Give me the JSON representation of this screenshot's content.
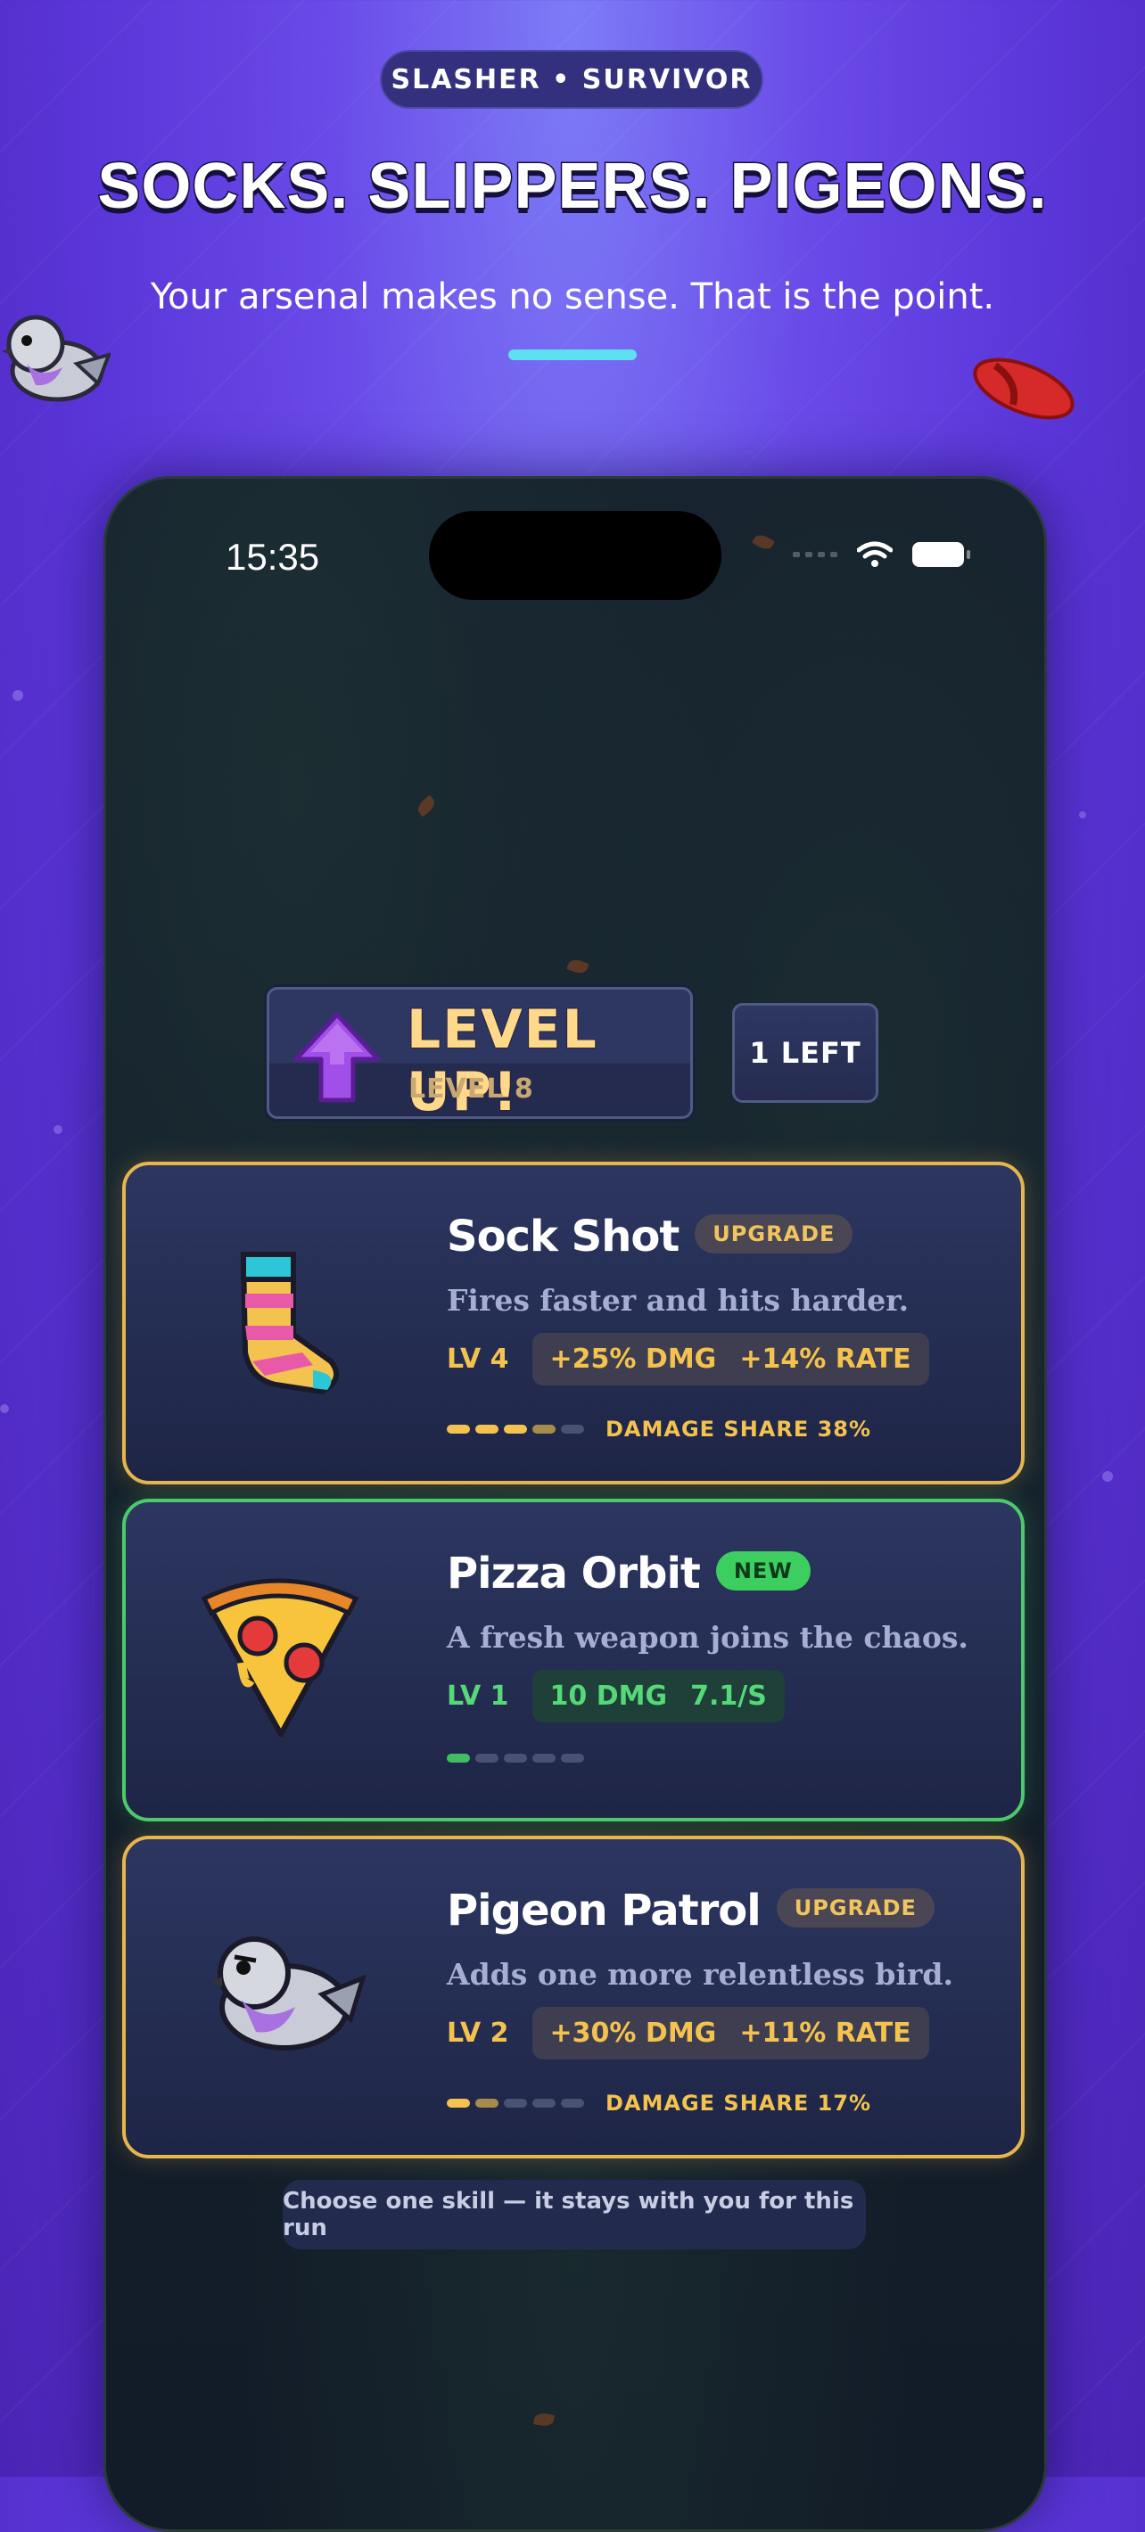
{
  "header": {
    "tag": "SLASHER • SURVIVOR",
    "headline": "SOCKS. SLIPPERS. PIGEONS.",
    "subtitle": "Your arsenal makes no sense. That is the point."
  },
  "status_bar": {
    "time": "15:35"
  },
  "level_up": {
    "title": "LEVEL UP!",
    "subtitle": "LEVEL 8",
    "remaining": "1 LEFT"
  },
  "cards": [
    {
      "title": "Sock Shot",
      "badge": "UPGRADE",
      "description": "Fires faster and hits harder.",
      "level": "LV 4",
      "stats": [
        "+25% DMG",
        "+14% RATE"
      ],
      "damage_share": "DAMAGE SHARE 38%",
      "icon": "sock-icon"
    },
    {
      "title": "Pizza Orbit",
      "badge": "NEW",
      "description": "A fresh weapon joins the chaos.",
      "level": "LV 1",
      "stats": [
        "10 DMG",
        "7.1/S"
      ],
      "icon": "pizza-icon"
    },
    {
      "title": "Pigeon Patrol",
      "badge": "UPGRADE",
      "description": "Adds one more relentless bird.",
      "level": "LV 2",
      "stats": [
        "+30% DMG",
        "+11% RATE"
      ],
      "damage_share": "DAMAGE SHARE 17%",
      "icon": "pigeon-icon"
    }
  ],
  "hint": "Choose one skill — it stays with you for this run",
  "colors": {
    "upgrade": "#e6b54e",
    "new": "#4cc96a",
    "accent": "#5fe0f2"
  }
}
